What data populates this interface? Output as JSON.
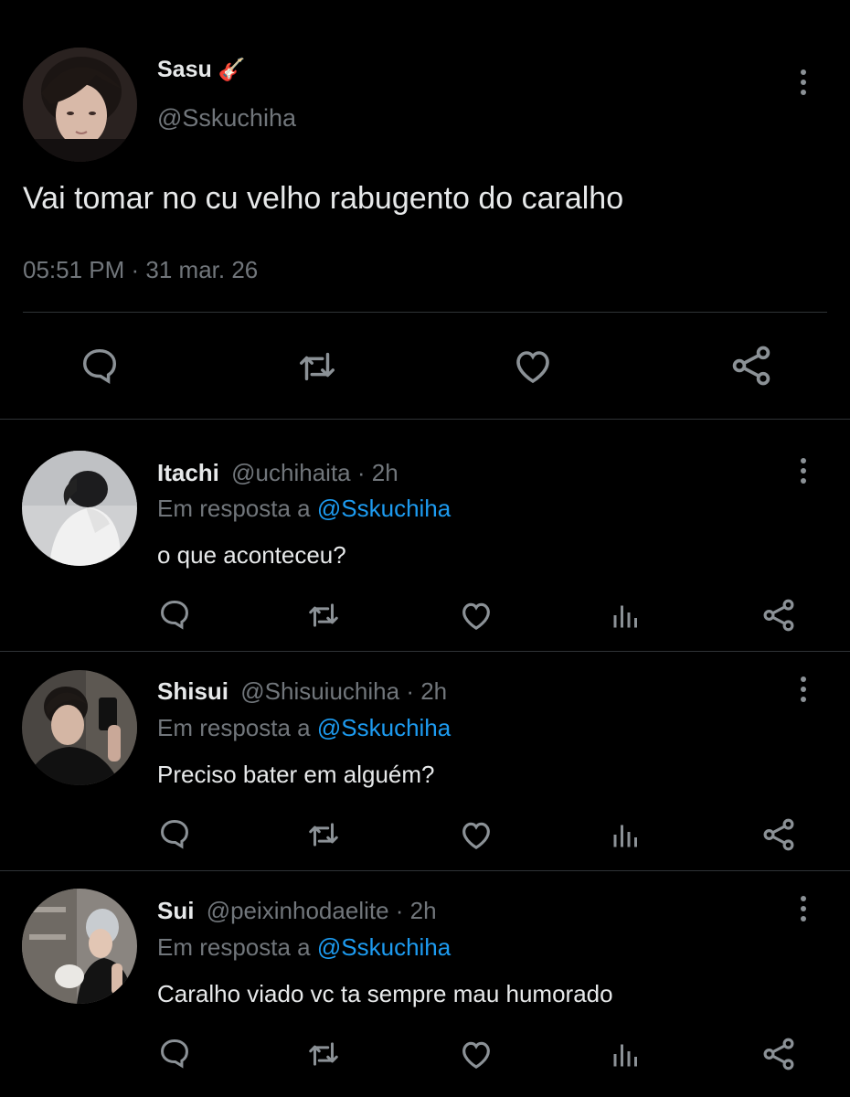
{
  "main_tweet": {
    "author_name": "Sasu",
    "author_emoji": "🎸",
    "handle": "@Sskuchiha",
    "text": "Vai tomar no cu velho rabugento do caralho",
    "timestamp": "05:51 PM · 31 mar. 26"
  },
  "replies": [
    {
      "name": "Itachi",
      "handle": "@uchihaita",
      "time": "· 2h",
      "reply_prefix": "Em resposta a",
      "reply_to": "@Sskuchiha",
      "text": "o que aconteceu?"
    },
    {
      "name": "Shisui",
      "handle": "@Shisuiuchiha",
      "time": "· 2h",
      "reply_prefix": "Em resposta a",
      "reply_to": "@Sskuchiha",
      "text": "Preciso bater em alguém?"
    },
    {
      "name": "Sui",
      "handle": "@peixinhodaelite",
      "time": "· 2h",
      "reply_prefix": "Em resposta a",
      "reply_to": "@Sskuchiha",
      "text": "Caralho viado vc ta sempre mau humorado"
    }
  ],
  "colors": {
    "background": "#000000",
    "text": "#e7e9ea",
    "secondary": "#71767b",
    "accent": "#1d9bf0",
    "divider": "#2f3336"
  },
  "icons": [
    "more-icon",
    "reply-icon",
    "retweet-icon",
    "like-icon",
    "views-icon",
    "share-icon"
  ]
}
